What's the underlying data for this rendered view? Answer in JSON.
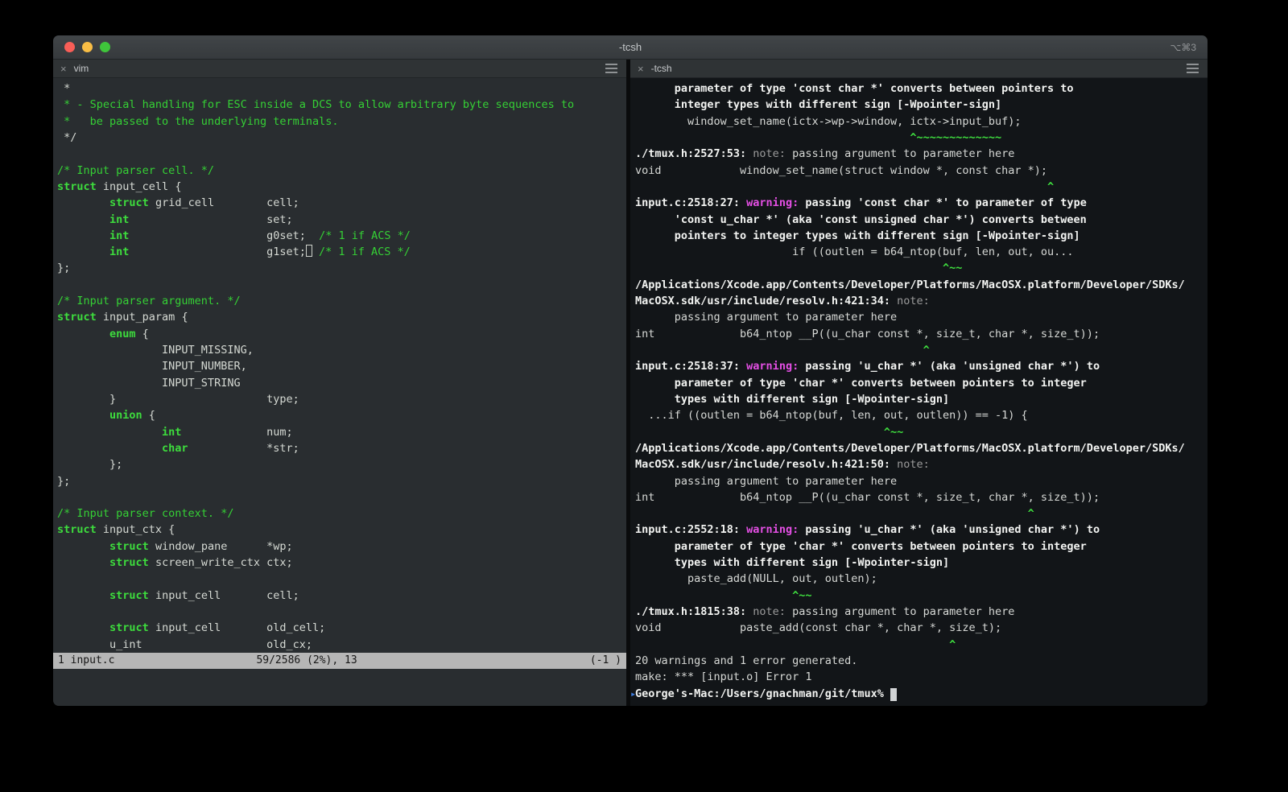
{
  "window": {
    "title": "-tcsh",
    "shortcut": "⌥⌘3",
    "traffic_colors": {
      "close": "#f95e57",
      "minimize": "#f8bd45",
      "zoom": "#3fc53b"
    }
  },
  "colors": {
    "keyword_green": "#3ddc3d",
    "comment_green": "#35d035",
    "caret_green": "#3fe03f",
    "warning_magenta": "#e44fe4",
    "note_gray": "#9b9b9b",
    "left_pane_bg": "#292d30",
    "right_pane_bg": "#121518",
    "statusline_bg": "#b6b6b6",
    "mark_blue": "#3f7ee0"
  },
  "left_pane": {
    "tab_title": "vim",
    "close_label": "×",
    "status": {
      "file": "1 input.c",
      "position": "59/2586 (2%), 13",
      "right": "(-1 )"
    },
    "lines": [
      [
        [
          "w",
          " *"
        ]
      ],
      [
        [
          "c",
          " * - Special handling for ESC inside a DCS to allow arbitrary byte sequences to"
        ]
      ],
      [
        [
          "c",
          " *   be passed to the underlying terminals."
        ]
      ],
      [
        [
          "w",
          " */"
        ]
      ],
      [],
      [
        [
          "c",
          "/* Input parser cell. */"
        ]
      ],
      [
        [
          "k",
          "struct"
        ],
        [
          "w",
          " input_cell {"
        ]
      ],
      [
        [
          "w",
          "        "
        ],
        [
          "k",
          "struct"
        ],
        [
          "w",
          " grid_cell        cell;"
        ]
      ],
      [
        [
          "w",
          "        "
        ],
        [
          "k",
          "int"
        ],
        [
          "w",
          "                     set;"
        ]
      ],
      [
        [
          "w",
          "        "
        ],
        [
          "k",
          "int"
        ],
        [
          "w",
          "                     g0set;  "
        ],
        [
          "c",
          "/* 1 if ACS */"
        ]
      ],
      [
        [
          "w",
          "        "
        ],
        [
          "k",
          "int"
        ],
        [
          "w",
          "                     g1set;"
        ],
        [
          "cur",
          " "
        ],
        [
          "w",
          " "
        ],
        [
          "c",
          "/* 1 if ACS */"
        ]
      ],
      [
        [
          "w",
          "};"
        ]
      ],
      [],
      [
        [
          "c",
          "/* Input parser argument. */"
        ]
      ],
      [
        [
          "k",
          "struct"
        ],
        [
          "w",
          " input_param {"
        ]
      ],
      [
        [
          "w",
          "        "
        ],
        [
          "k",
          "enum"
        ],
        [
          "w",
          " {"
        ]
      ],
      [
        [
          "w",
          "                INPUT_MISSING,"
        ]
      ],
      [
        [
          "w",
          "                INPUT_NUMBER,"
        ]
      ],
      [
        [
          "w",
          "                INPUT_STRING"
        ]
      ],
      [
        [
          "w",
          "        }                       type;"
        ]
      ],
      [
        [
          "w",
          "        "
        ],
        [
          "k",
          "union"
        ],
        [
          "w",
          " {"
        ]
      ],
      [
        [
          "w",
          "                "
        ],
        [
          "k",
          "int"
        ],
        [
          "w",
          "             num;"
        ]
      ],
      [
        [
          "w",
          "                "
        ],
        [
          "k",
          "char"
        ],
        [
          "w",
          "            *str;"
        ]
      ],
      [
        [
          "w",
          "        };"
        ]
      ],
      [
        [
          "w",
          "};"
        ]
      ],
      [],
      [
        [
          "c",
          "/* Input parser context. */"
        ]
      ],
      [
        [
          "k",
          "struct"
        ],
        [
          "w",
          " input_ctx {"
        ]
      ],
      [
        [
          "w",
          "        "
        ],
        [
          "k",
          "struct"
        ],
        [
          "w",
          " window_pane      *wp;"
        ]
      ],
      [
        [
          "w",
          "        "
        ],
        [
          "k",
          "struct"
        ],
        [
          "w",
          " screen_write_ctx ctx;"
        ]
      ],
      [],
      [
        [
          "w",
          "        "
        ],
        [
          "k",
          "struct"
        ],
        [
          "w",
          " input_cell       cell;"
        ]
      ],
      [],
      [
        [
          "w",
          "        "
        ],
        [
          "k",
          "struct"
        ],
        [
          "w",
          " input_cell       old_cell;"
        ]
      ],
      [
        [
          "w",
          "        u_int                   old_cx;"
        ]
      ]
    ]
  },
  "right_pane": {
    "tab_title": "-tcsh",
    "close_label": "×",
    "lines": [
      [
        [
          "b",
          "      parameter of type 'const char *' converts between pointers to"
        ]
      ],
      [
        [
          "b",
          "      integer types with different sign [-Wpointer-sign]"
        ]
      ],
      [
        [
          "p",
          "        window_set_name(ictx->wp->window, ictx->input_buf);"
        ]
      ],
      [
        [
          "g",
          "                                          ^~~~~~~~~~~~~~"
        ]
      ],
      [
        [
          "b",
          "./tmux.h:2527:53:"
        ],
        [
          "n",
          " note: "
        ],
        [
          "p",
          "passing argument to parameter here"
        ]
      ],
      [
        [
          "p",
          "void            window_set_name(struct window *, const char *);"
        ]
      ],
      [
        [
          "g",
          "                                                               ^"
        ]
      ],
      [
        [
          "b",
          "input.c:2518:27:"
        ],
        [
          "m",
          " warning: "
        ],
        [
          "b",
          "passing 'const char *' to parameter of type"
        ]
      ],
      [
        [
          "b",
          "      'const u_char *' (aka 'const unsigned char *') converts between"
        ]
      ],
      [
        [
          "b",
          "      pointers to integer types with different sign [-Wpointer-sign]"
        ]
      ],
      [
        [
          "p",
          "                        if ((outlen = b64_ntop(buf, len, out, ou..."
        ]
      ],
      [
        [
          "g",
          "                                               ^~~"
        ]
      ],
      [
        [
          "b",
          "/Applications/Xcode.app/Contents/Developer/Platforms/MacOSX.platform/Developer/SDKs/"
        ]
      ],
      [
        [
          "b",
          "MacOSX.sdk/usr/include/resolv.h:421:34:"
        ],
        [
          "n",
          " note:"
        ]
      ],
      [
        [
          "p",
          "      passing argument to parameter here"
        ]
      ],
      [
        [
          "p",
          "int             b64_ntop __P((u_char const *, size_t, char *, size_t));"
        ]
      ],
      [
        [
          "g",
          "                                            ^"
        ]
      ],
      [
        [
          "b",
          "input.c:2518:37:"
        ],
        [
          "m",
          " warning: "
        ],
        [
          "b",
          "passing 'u_char *' (aka 'unsigned char *') to"
        ]
      ],
      [
        [
          "b",
          "      parameter of type 'char *' converts between pointers to integer"
        ]
      ],
      [
        [
          "b",
          "      types with different sign [-Wpointer-sign]"
        ]
      ],
      [
        [
          "p",
          "  ...if ((outlen = b64_ntop(buf, len, out, outlen)) == -1) {"
        ]
      ],
      [
        [
          "g",
          "                                      ^~~"
        ]
      ],
      [
        [
          "b",
          "/Applications/Xcode.app/Contents/Developer/Platforms/MacOSX.platform/Developer/SDKs/"
        ]
      ],
      [
        [
          "b",
          "MacOSX.sdk/usr/include/resolv.h:421:50:"
        ],
        [
          "n",
          " note:"
        ]
      ],
      [
        [
          "p",
          "      passing argument to parameter here"
        ]
      ],
      [
        [
          "p",
          "int             b64_ntop __P((u_char const *, size_t, char *, size_t));"
        ]
      ],
      [
        [
          "g",
          "                                                            ^"
        ]
      ],
      [
        [
          "b",
          "input.c:2552:18:"
        ],
        [
          "m",
          " warning: "
        ],
        [
          "b",
          "passing 'u_char *' (aka 'unsigned char *') to"
        ]
      ],
      [
        [
          "b",
          "      parameter of type 'char *' converts between pointers to integer"
        ]
      ],
      [
        [
          "b",
          "      types with different sign [-Wpointer-sign]"
        ]
      ],
      [
        [
          "p",
          "        paste_add(NULL, out, outlen);"
        ]
      ],
      [
        [
          "g",
          "                        ^~~"
        ]
      ],
      [
        [
          "b",
          "./tmux.h:1815:38:"
        ],
        [
          "n",
          " note: "
        ],
        [
          "p",
          "passing argument to parameter here"
        ]
      ],
      [
        [
          "p",
          "void            paste_add(const char *, char *, size_t);"
        ]
      ],
      [
        [
          "g",
          "                                                ^"
        ]
      ],
      [
        [
          "p",
          "20 warnings and 1 error generated."
        ]
      ],
      [
        [
          "p",
          "make: *** [input.o] Error 1"
        ]
      ],
      [
        [
          "mark",
          "▸"
        ],
        [
          "b",
          "George's-Mac:/Users/gnachman/git/tmux% "
        ],
        [
          "cursor",
          " "
        ]
      ]
    ]
  }
}
